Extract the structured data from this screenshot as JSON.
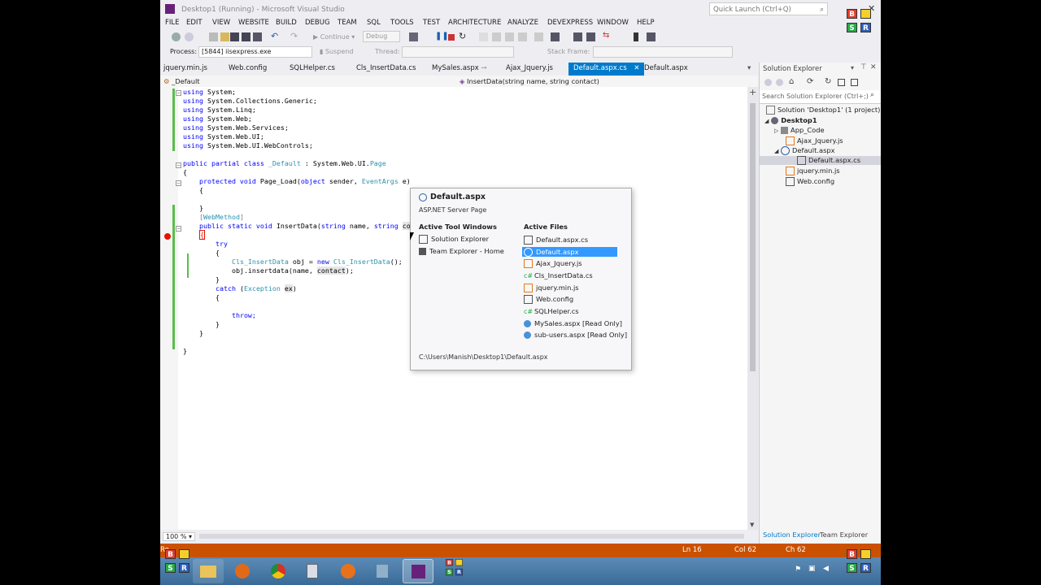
{
  "window": {
    "title": "Desktop1 (Running) - Microsoft Visual Studio",
    "quick_launch_placeholder": "Quick Launch (Ctrl+Q)"
  },
  "menu": [
    "FILE",
    "EDIT",
    "VIEW",
    "WEBSITE",
    "BUILD",
    "DEBUG",
    "TEAM",
    "SQL",
    "TOOLS",
    "TEST",
    "ARCHITECTURE",
    "ANALYZE",
    "DEVEXPRESS",
    "WINDOW",
    "HELP"
  ],
  "toolbar": {
    "continue_label": "Continue",
    "config_value": "Debug",
    "suspend_label": "Suspend",
    "thread_label": "Thread:",
    "stack_frame_label": "Stack Frame:"
  },
  "process": {
    "label": "Process:",
    "value": "[5844] iisexpress.exe"
  },
  "tabs": [
    {
      "label": "jquery.min.js"
    },
    {
      "label": "Web.config"
    },
    {
      "label": "SQLHelper.cs"
    },
    {
      "label": "Cls_InsertData.cs"
    },
    {
      "label": "MySales.aspx"
    },
    {
      "label": "Ajax_Jquery.js"
    },
    {
      "label": "Default.aspx.cs"
    },
    {
      "label": "Default.aspx"
    }
  ],
  "active_tab_index": 6,
  "navbar": {
    "class_value": "_Default",
    "member_value": "InsertData(string name, string contact)"
  },
  "code": {
    "using1": "System;",
    "using2": "System.Collections.Generic;",
    "using3": "System.Linq;",
    "using4": "System.Web;",
    "using5": "System.Web.Services;",
    "using6": "System.Web.UI;",
    "using7": "System.Web.UI.WebControls;",
    "class_decl_name": "_Default",
    "class_decl_base": "System.Web.UI.",
    "class_decl_page": "Page",
    "page_load": "Page_Load(",
    "page_load_args": " sender, ",
    "event_args": "EventArgs",
    "page_load_end": " e)",
    "attribute": "WebMethod",
    "method_name": "InsertData(",
    "method_args": " name, ",
    "method_args_end": "con",
    "obj_type": "Cls_InsertData",
    "obj_line_mid": " obj = ",
    "obj_line_end": "();",
    "call_line": "obj.insertdata(name, ",
    "call_arg": "contact",
    "call_end": ");",
    "exception_type": "Exception",
    "ex_var": "ex",
    "throw_kw": "throw;"
  },
  "zoom": "100 %",
  "status": {
    "left": "Re",
    "ln": "Ln 16",
    "col": "Col 62",
    "ch": "Ch 62"
  },
  "solution_explorer": {
    "title": "Solution Explorer",
    "search_placeholder": "Search Solution Explorer (Ctrl+;)",
    "items": [
      {
        "label": "Solution 'Desktop1' (1 project)"
      },
      {
        "label": "Desktop1"
      },
      {
        "label": "App_Code"
      },
      {
        "label": "Ajax_Jquery.js"
      },
      {
        "label": "Default.aspx"
      },
      {
        "label": "Default.aspx.cs"
      },
      {
        "label": "jquery.min.js"
      },
      {
        "label": "Web.config"
      }
    ],
    "bottom_tabs": [
      "Solution Explorer",
      "Team Explorer"
    ]
  },
  "navigator_popup": {
    "title": "Default.aspx",
    "subtitle": "ASP.NET Server Page",
    "tool_windows_header": "Active Tool Windows",
    "tool_windows": [
      "Solution Explorer",
      "Team Explorer - Home"
    ],
    "files_header": "Active Files",
    "files": [
      "Default.aspx.cs",
      "Default.aspx",
      "Ajax_Jquery.js",
      "Cls_InsertData.cs",
      "jquery.min.js",
      "Web.config",
      "SQLHelper.cs",
      "MySales.aspx [Read Only]",
      "sub-users.aspx [Read Only]"
    ],
    "selected_file_index": 1,
    "path": "C:\\Users\\Manish\\Desktop1\\Default.aspx"
  },
  "logo": {
    "letters": [
      "B",
      "",
      "S",
      "R"
    ],
    "colors": [
      "#e03c31",
      "#f5d02a",
      "#2aa84a",
      "#2f5fb8"
    ]
  }
}
